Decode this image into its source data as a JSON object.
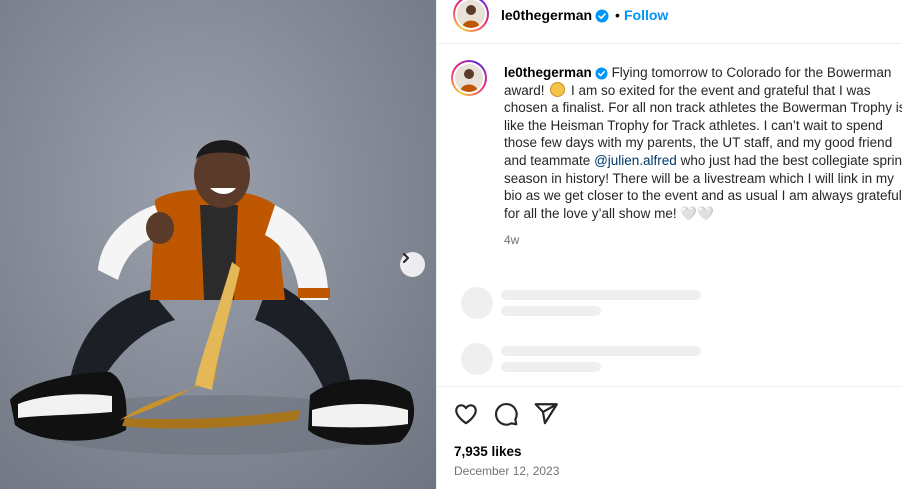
{
  "post": {
    "username": "le0thegerman",
    "follow_label": "Follow",
    "separator": "•",
    "more_label": "⋮",
    "caption_text": "Flying tomorrow to Colorado for the Bowerman award! ",
    "caption_text_2": " I am so exited for the event and grateful that I was chosen a finalist. For all non track athletes the Bowerman Trophy is like the Heisman Trophy for Track athletes. I can’t wait to spend those few days with my parents, the UT staff, and my good friend and teammate ",
    "mention": "@julien.alfred",
    "caption_text_3": " who just had the best collegiate sprint season in history! There will be a livestream which I will link in my bio as we get closer to the event and as usual I am always grateful for all the love y’all show me! ",
    "caption_trailing_glyphs": "🤍🤍",
    "time_ago": "4w",
    "likes": "7,935 likes",
    "date": "December 12, 2023"
  },
  "icons": {
    "verified": "verified-badge-icon",
    "like": "heart-icon",
    "comment": "comment-icon",
    "share": "paper-plane-icon",
    "next": "chevron-right-icon"
  },
  "colors": {
    "accent": "#0095f6",
    "mention": "#00376b",
    "muted": "#737373",
    "skeleton": "#efefef",
    "photo_background": "#8a909c",
    "jacket": "#bf5700"
  }
}
